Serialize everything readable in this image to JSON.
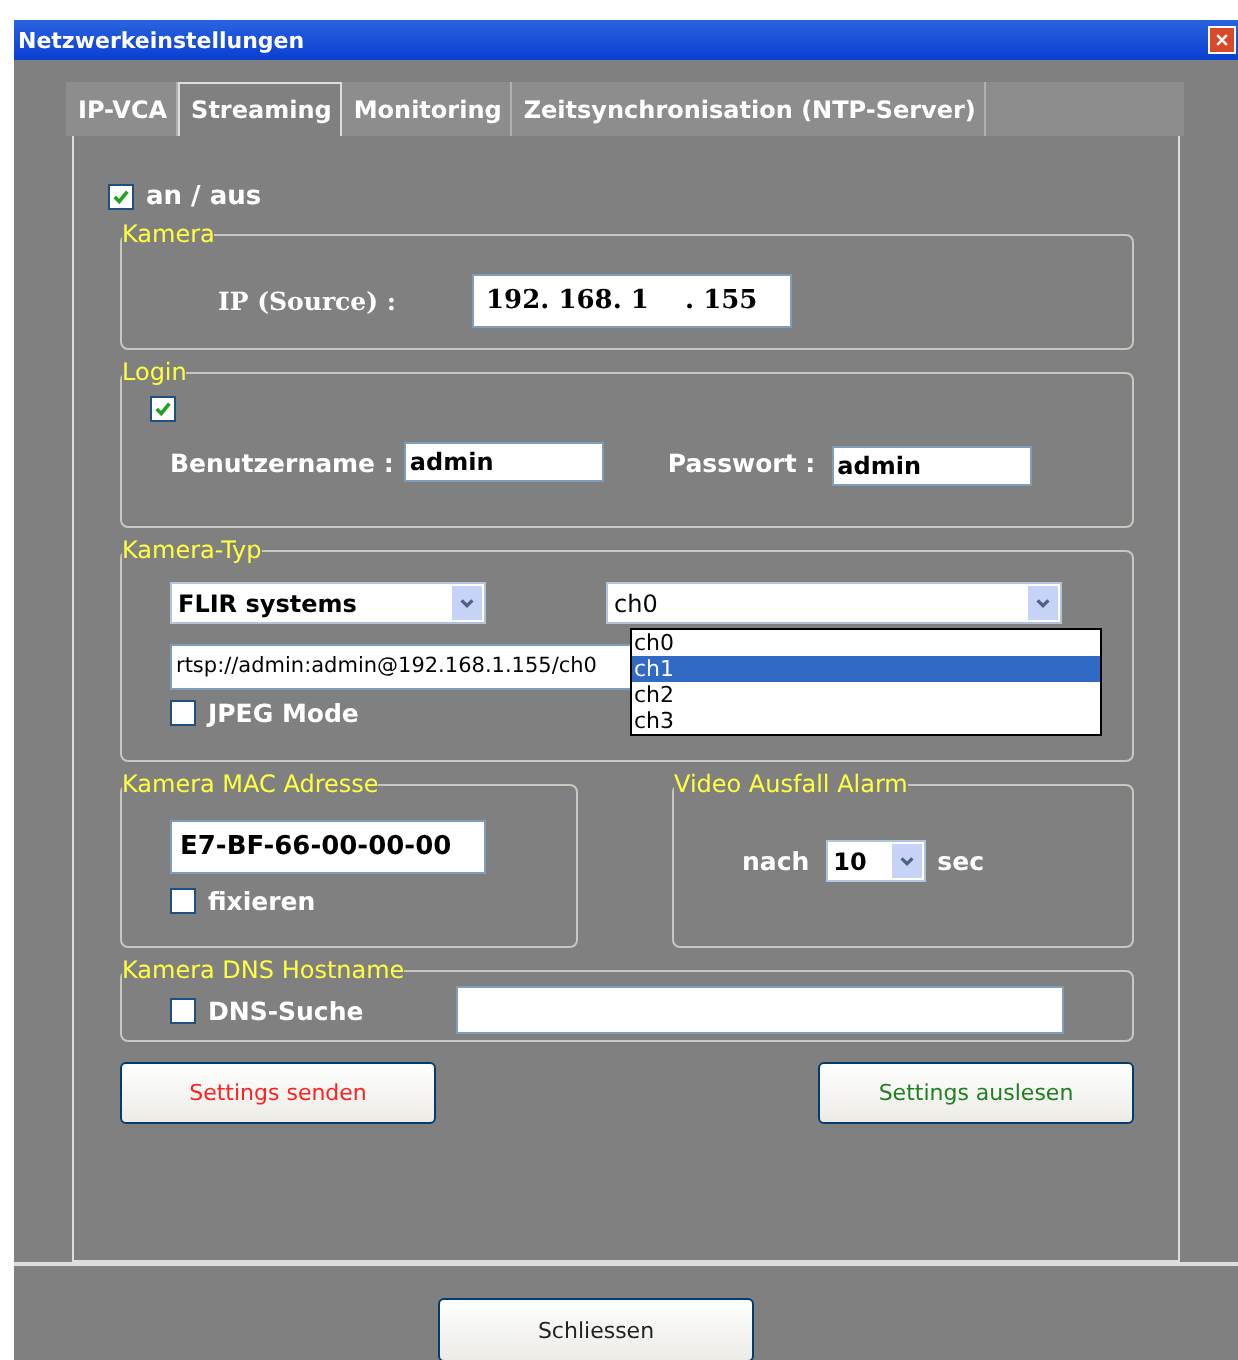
{
  "window": {
    "title": "Netzwerkeinstellungen"
  },
  "tabs": [
    {
      "label": "IP-VCA",
      "selected": false
    },
    {
      "label": "Streaming",
      "selected": true
    },
    {
      "label": "Monitoring",
      "selected": false
    },
    {
      "label": "Zeitsynchronisation (NTP-Server)",
      "selected": false
    }
  ],
  "enable": {
    "label": "an / aus",
    "checked": true
  },
  "camera": {
    "legend": "Kamera",
    "ip_label": "IP (Source) :",
    "ip_value": "192. 168. 1    . 155"
  },
  "login": {
    "legend": "Login",
    "checked": true,
    "user_label": "Benutzername :",
    "user_value": "admin",
    "password_label": "Passwort :",
    "password_value": "admin"
  },
  "camera_type": {
    "legend": "Kamera-Typ",
    "vendor": "FLIR systems",
    "channel": "ch0",
    "url": "rtsp://admin:admin@192.168.1.155/ch0",
    "jpeg_label": "JPEG Mode",
    "jpeg_checked": false,
    "channel_options": [
      {
        "label": "ch0",
        "selected": false
      },
      {
        "label": "ch1",
        "selected": true
      },
      {
        "label": "ch2",
        "selected": false
      },
      {
        "label": "ch3",
        "selected": false
      }
    ]
  },
  "mac": {
    "legend": "Kamera MAC Adresse",
    "value": "E7-BF-66-00-00-00",
    "fix_label": "fixieren",
    "fix_checked": false
  },
  "alarm": {
    "legend": "Video Ausfall Alarm",
    "before": "nach",
    "value": "10",
    "after": "sec"
  },
  "dns": {
    "legend": "Kamera DNS Hostname",
    "label": "DNS-Suche",
    "checked": false
  },
  "buttons": [
    {
      "label": "Settings senden",
      "color": "#ff2020"
    },
    {
      "label": "Settings auslesen",
      "color": "#208020"
    }
  ],
  "close_button": "Schliessen"
}
